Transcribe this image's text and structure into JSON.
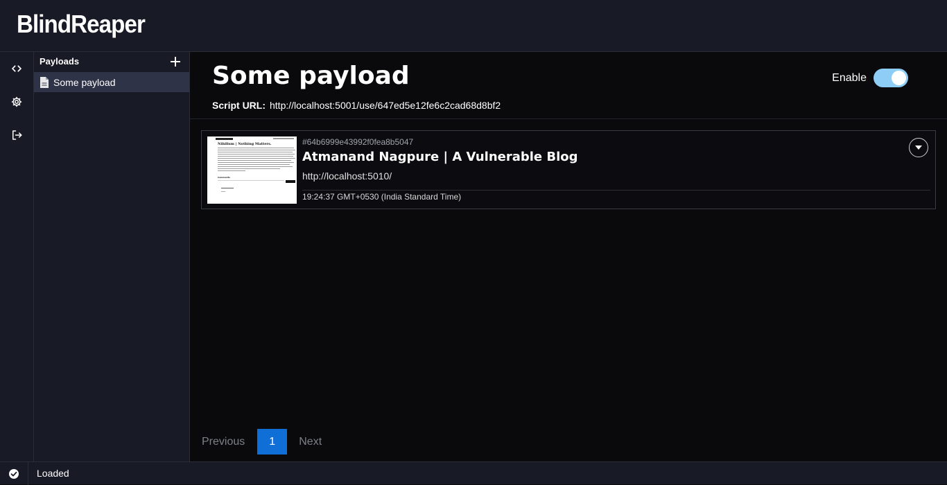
{
  "app": {
    "brand": "BlindReaper"
  },
  "rail": {
    "items": [
      {
        "icon": "code-icon"
      },
      {
        "icon": "gear-icon"
      },
      {
        "icon": "logout-icon"
      }
    ]
  },
  "sidebar": {
    "title": "Payloads",
    "add_icon": "plus-icon",
    "items": [
      {
        "label": "Some payload",
        "icon": "document-icon",
        "selected": true
      }
    ]
  },
  "main": {
    "title": "Some payload",
    "script_url_label": "Script URL:",
    "script_url": "http://localhost:5001/use/647ed5e12fe6c2cad68d8bf2",
    "enable_label": "Enable",
    "enabled": true
  },
  "results": [
    {
      "id": "#64b6999e43992f0fea8b5047",
      "title": "Atmanand Nagpure | A Vulnerable Blog",
      "url": "http://localhost:5010/",
      "time": "19:24:37 GMT+0530 (India Standard Time)",
      "thumbnail_heading": "Nihilism | Nothing Matters.",
      "thumbnail_subheading": "Comments"
    }
  ],
  "pagination": {
    "prev_label": "Previous",
    "current_page": "1",
    "next_label": "Next"
  },
  "status": {
    "text": "Loaded",
    "icon": "check-circle-icon"
  },
  "colors": {
    "accent": "#0f6fd6",
    "toggle": "#8ecdf5",
    "panel": "#181a26",
    "background": "#0a0a0c",
    "selected_item": "#2e3347"
  }
}
